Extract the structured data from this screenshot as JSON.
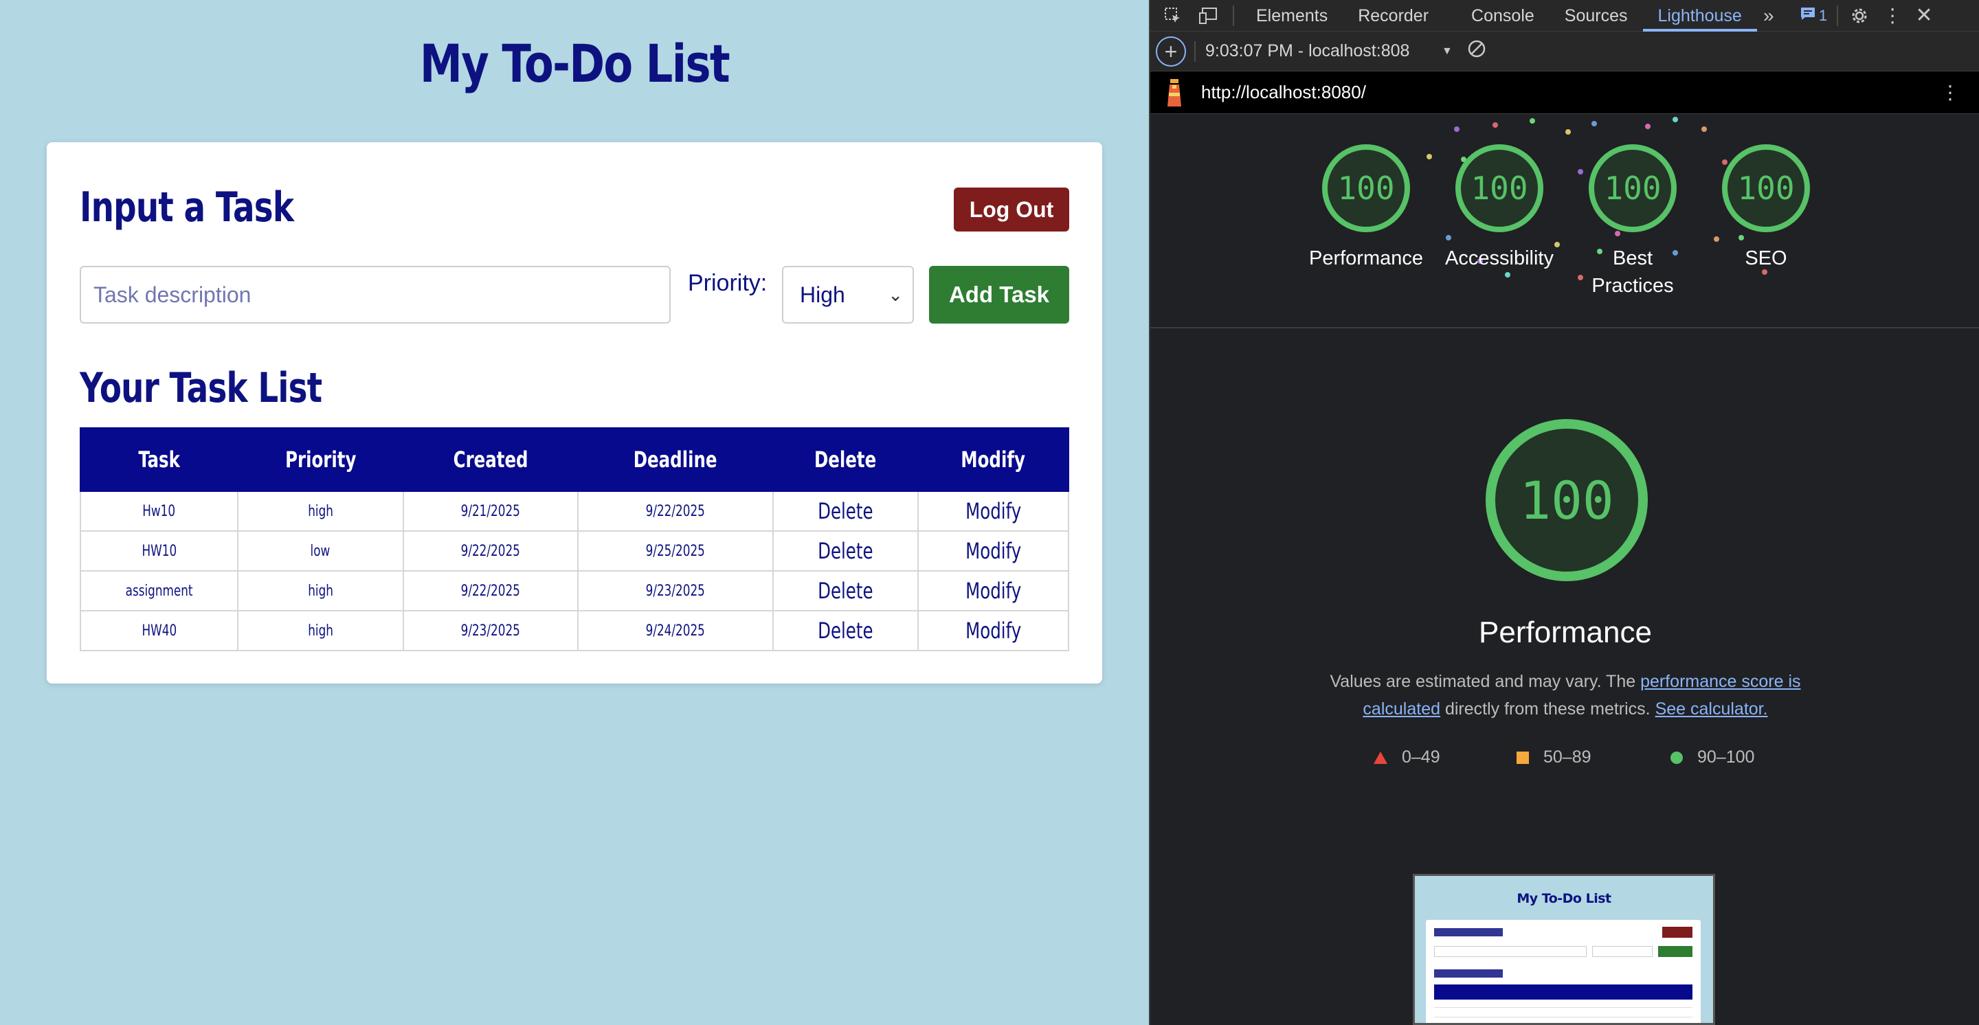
{
  "app": {
    "title": "My To-Do List",
    "input_section_title": "Input a Task",
    "logout_label": "Log Out",
    "task_placeholder": "Task description",
    "priority_label": "Priority:",
    "priority_selected": "High",
    "add_task_label": "Add Task",
    "list_title": "Your Task List",
    "table": {
      "headers": [
        "Task",
        "Priority",
        "Created",
        "Deadline",
        "Delete",
        "Modify"
      ],
      "rows": [
        {
          "task": "Hw10",
          "priority": "high",
          "created": "9/21/2025",
          "deadline": "9/22/2025",
          "delete": "Delete",
          "modify": "Modify"
        },
        {
          "task": "HW10",
          "priority": "low",
          "created": "9/22/2025",
          "deadline": "9/25/2025",
          "delete": "Delete",
          "modify": "Modify"
        },
        {
          "task": "assignment",
          "priority": "high",
          "created": "9/22/2025",
          "deadline": "9/23/2025",
          "delete": "Delete",
          "modify": "Modify"
        },
        {
          "task": "HW40",
          "priority": "high",
          "created": "9/23/2025",
          "deadline": "9/24/2025",
          "delete": "Delete",
          "modify": "Modify"
        }
      ]
    }
  },
  "devtools": {
    "tabs": [
      "Elements",
      "Recorder",
      "Console",
      "Sources",
      "Lighthouse"
    ],
    "active_tab": "Lighthouse",
    "issues_count": "1",
    "report_selector": "9:03:07 PM - localhost:808",
    "url": "http://localhost:8080/",
    "scores": [
      {
        "value": "100",
        "label": "Performance"
      },
      {
        "value": "100",
        "label": "Accessibility"
      },
      {
        "value": "100",
        "label": "Best Practices"
      },
      {
        "value": "100",
        "label": "SEO"
      }
    ],
    "main_score": "100",
    "main_label": "Performance",
    "note_prefix": "Values are estimated and may vary. The ",
    "note_link1": "performance score is calculated",
    "note_middle": " directly from these metrics. ",
    "note_link2": "See calculator.",
    "legend": [
      {
        "range": "0–49",
        "color": "#e8453c"
      },
      {
        "range": "50–89",
        "color": "#f4a93b"
      },
      {
        "range": "90–100",
        "color": "#57c267"
      }
    ],
    "thumb_title": "My To-Do List",
    "score_color": "#57c267"
  }
}
